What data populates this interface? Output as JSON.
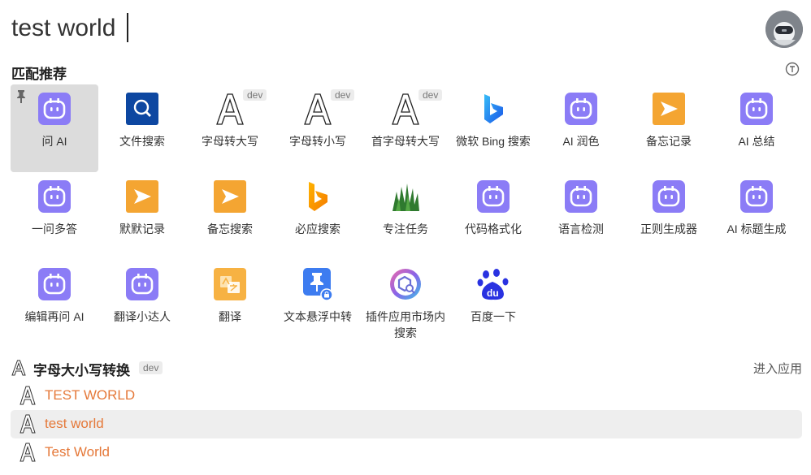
{
  "search": {
    "value": "test world"
  },
  "section": {
    "title": "匹配推荐"
  },
  "dev_badge": "dev",
  "tiles": [
    {
      "label": "问 AI",
      "icon": "robot-icon"
    },
    {
      "label": "文件搜索",
      "icon": "file-search-icon"
    },
    {
      "label": "字母转大写",
      "icon": "letter-a-icon"
    },
    {
      "label": "字母转小写",
      "icon": "letter-a-icon"
    },
    {
      "label": "首字母转大写",
      "icon": "letter-a-icon"
    },
    {
      "label": "微软 Bing 搜索",
      "icon": "bing-icon"
    },
    {
      "label": "AI 润色",
      "icon": "robot-icon"
    },
    {
      "label": "备忘记录",
      "icon": "memo-icon"
    },
    {
      "label": "AI 总结",
      "icon": "robot-icon"
    },
    {
      "label": "一问多答",
      "icon": "robot-icon"
    },
    {
      "label": "默默记录",
      "icon": "memo-icon"
    },
    {
      "label": "备忘搜索",
      "icon": "memo-icon"
    },
    {
      "label": "必应搜索",
      "icon": "bing-icon"
    },
    {
      "label": "专注任务",
      "icon": "grass-icon"
    },
    {
      "label": "代码格式化",
      "icon": "robot-icon"
    },
    {
      "label": "语言检测",
      "icon": "robot-icon"
    },
    {
      "label": "正则生成器",
      "icon": "robot-icon"
    },
    {
      "label": "AI 标题生成",
      "icon": "robot-icon"
    },
    {
      "label": "编辑再问 AI",
      "icon": "robot-icon"
    },
    {
      "label": "翻译小达人",
      "icon": "robot-icon"
    },
    {
      "label": "翻译",
      "icon": "translate-icon"
    },
    {
      "label": "文本悬浮中转",
      "icon": "pin-float-icon"
    },
    {
      "label": "插件应用市场内搜索",
      "icon": "plugin-market-icon"
    },
    {
      "label": "百度一下",
      "icon": "baidu-paw-icon"
    }
  ],
  "result_section": {
    "title": "字母大小写转换",
    "badge": "dev",
    "enter_label": "进入应用"
  },
  "results": [
    {
      "text": "TEST WORLD"
    },
    {
      "text": "test world"
    },
    {
      "text": "Test World"
    }
  ],
  "colors": {
    "accent": "#e5793a",
    "robot": "#8b7cf6",
    "memo": "#f4a532",
    "file_search": "#0d47a1"
  }
}
